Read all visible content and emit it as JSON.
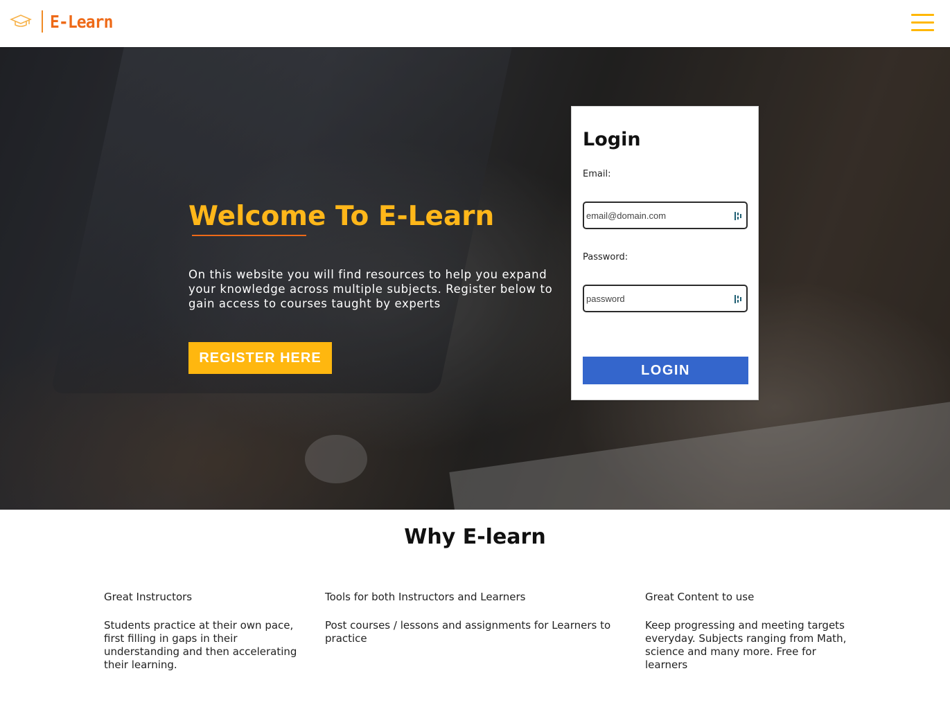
{
  "nav": {
    "brand_name": "E-Learn",
    "brand_icon": "graduation-cap-icon",
    "menu_icon": "hamburger-menu-icon",
    "accent_color": "#ffb703",
    "brand_color": "#ee6a18"
  },
  "hero": {
    "title": "Welcome To E-Learn",
    "description": "On this website you will find resources to help you expand your knowledge across multiple subjects. Register below to gain access to courses taught by experts",
    "register_label": "REGISTER HERE"
  },
  "login": {
    "title": "Login",
    "email_label": "Email:",
    "email_placeholder": "email@domain.com",
    "password_label": "Password:",
    "password_placeholder": "password",
    "button_label": "LOGIN",
    "button_color": "#3466cc"
  },
  "why": {
    "title": "Why E-learn",
    "features": [
      {
        "title": "Great Instructors",
        "description": "Students practice at their own pace, first filling in gaps in their understanding and then accelerating their learning."
      },
      {
        "title": "Tools for both Instructors and Learners",
        "description": "Post courses / lessons and assignments for Learners to practice"
      },
      {
        "title": "Great Content to use",
        "description": "Keep progressing and meeting targets everyday. Subjects ranging from Math, science and many more. Free for learners"
      }
    ]
  }
}
